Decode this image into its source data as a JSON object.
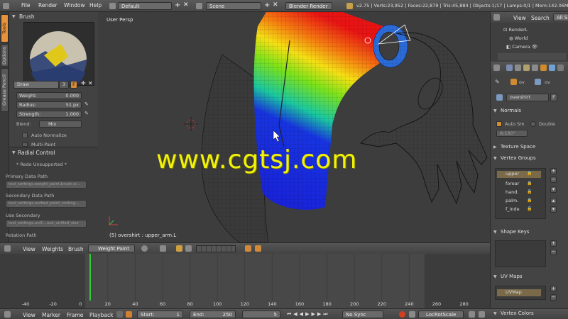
{
  "menu": {
    "file": "File",
    "render": "Render",
    "window": "Window",
    "help": "Help"
  },
  "screen_layout": "Default",
  "scene": "Scene",
  "render_engine": "Blender Render",
  "stats": "v2.75 | Verts:23,952 | Faces:22,879 | Tris:45,884 | Objects:1/17 | Lamps:0/1 | Mem:142.06M",
  "tabs": {
    "tools": "Tools",
    "options": "Options",
    "grease": "Grease Pencil"
  },
  "brush": {
    "title": "Brush",
    "name": "Draw",
    "users": "3",
    "fake": "F",
    "weight_label": "Weight:",
    "weight": "0.000",
    "radius_label": "Radius:",
    "radius": "51 px",
    "strength_label": "Strength:",
    "strength": "1.000",
    "blend_label": "Blend:",
    "blend": "Mix",
    "auto_normalize": "Auto Normalize",
    "multi_paint": "Multi-Paint"
  },
  "radial": {
    "title": "Radial Control",
    "redo": "* Redo Unsupported *",
    "primary_label": "Primary Data Path",
    "primary": "tool_settings.weight_paint.brush.si...",
    "secondary_label": "Secondary Data Path",
    "secondary": "tool_settings.unified_paint_setting...",
    "use_secondary_label": "Use Secondary",
    "use_secondary": "tool_settings.unif....use_unified_size",
    "rotation_label": "Rotation Path"
  },
  "viewport": {
    "label": "User Persp",
    "object_info": "(5) overshirt : upper_arm.L"
  },
  "watermark": "www.cgtsj.com",
  "view_header": {
    "view": "View",
    "weights": "Weights",
    "brush": "Brush",
    "mode": "Weight Paint"
  },
  "timeline": {
    "ticks": [
      "-40",
      "-20",
      "0",
      "20",
      "40",
      "60",
      "80",
      "100",
      "120",
      "140",
      "160",
      "180",
      "200",
      "220",
      "240",
      "260",
      "280"
    ],
    "current_frame": 5
  },
  "bottom": {
    "view": "View",
    "marker": "Marker",
    "frame": "Frame",
    "playback": "Playback",
    "start_label": "Start:",
    "start": "1",
    "end_label": "End:",
    "end": "250",
    "current": "5",
    "sync": "No Sync",
    "keying": "LocRotScale"
  },
  "outliner": {
    "view": "View",
    "search": "Search",
    "all": "All S",
    "items": [
      "RenderL",
      "World",
      "Camera"
    ]
  },
  "props": {
    "object_name": "overshirt",
    "f": "F",
    "ov1": "ov",
    "ov2": "ov",
    "normals": "Normals",
    "auto_smooth": "Auto Sm",
    "double": "Double",
    "angle": "A:180°",
    "texture_space": "Texture Space",
    "vertex_groups": "Vertex Groups",
    "groups": [
      "upper",
      "forear",
      "hand.",
      "palm.",
      "f_inde"
    ],
    "shape_keys": "Shape Keys",
    "uv_maps": "UV Maps",
    "uvmap": "UVMap",
    "vertex_colors": "Vertex Colors"
  }
}
